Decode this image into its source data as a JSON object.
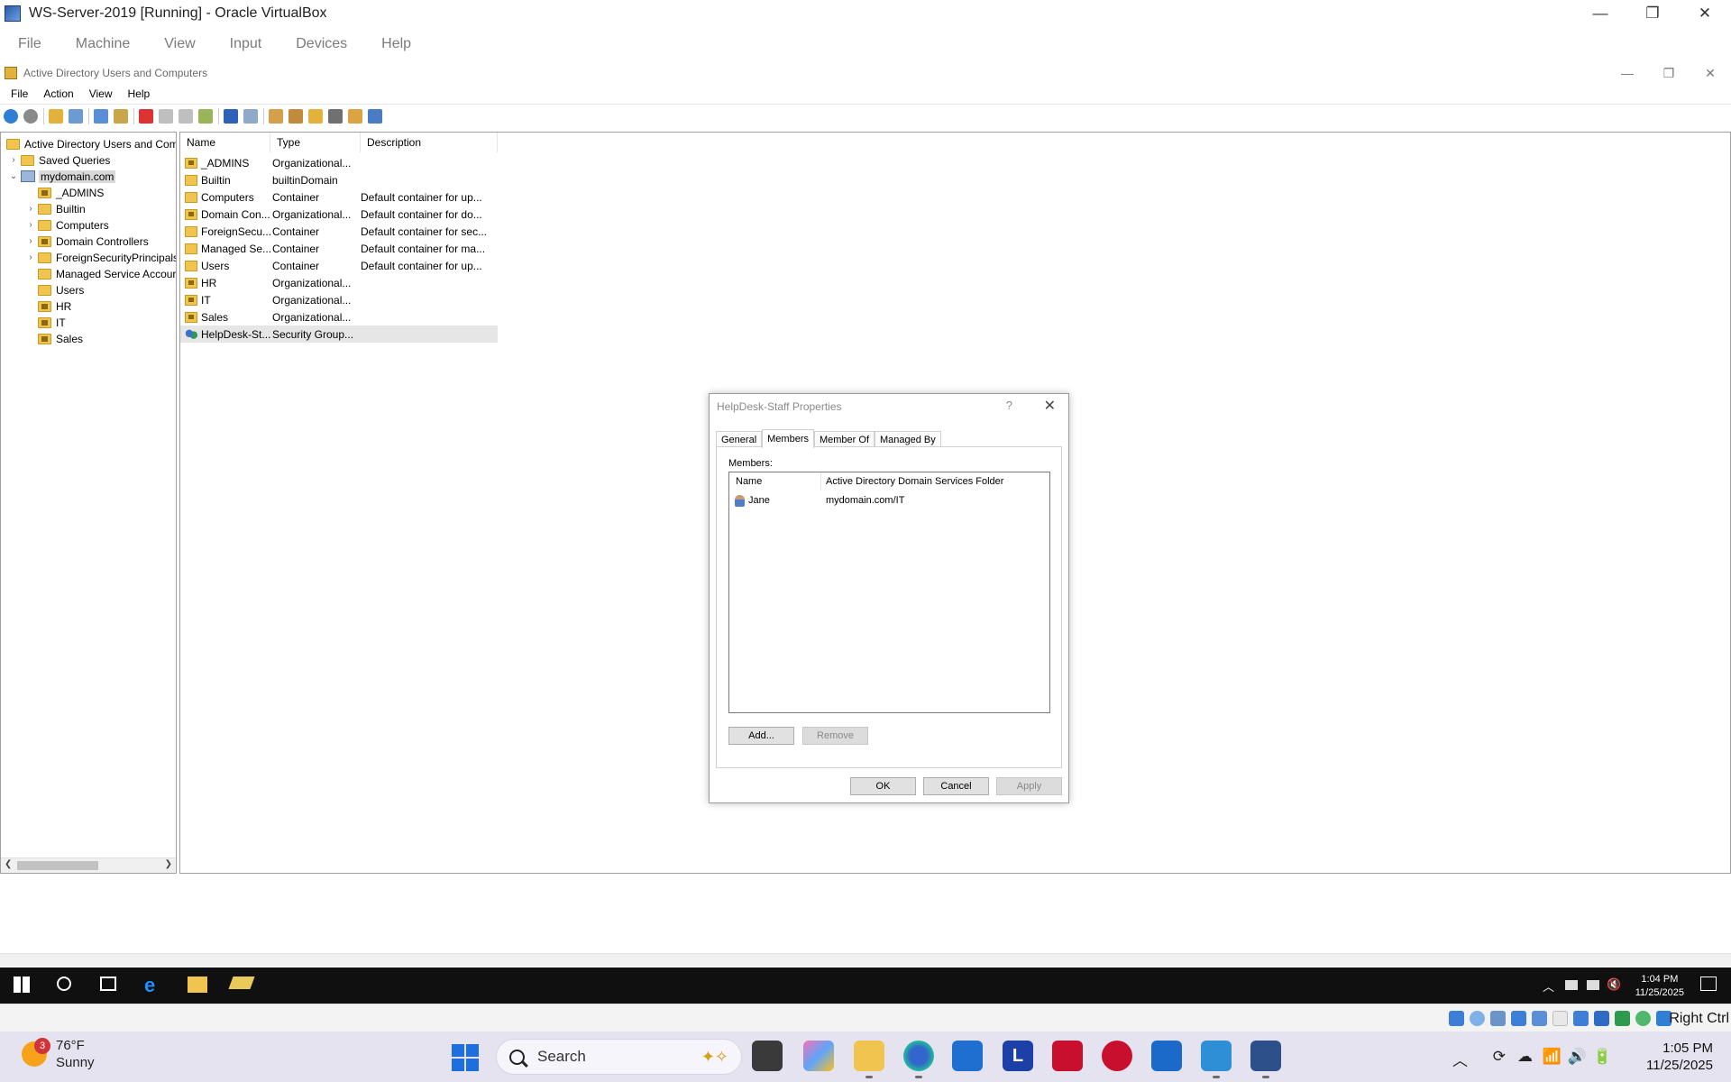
{
  "vbox": {
    "title": "WS-Server-2019 [Running] - Oracle VirtualBox",
    "menu": [
      "File",
      "Machine",
      "View",
      "Input",
      "Devices",
      "Help"
    ],
    "host_key": "Right Ctrl"
  },
  "aduc": {
    "title": "Active Directory Users and Computers",
    "menu": [
      "File",
      "Action",
      "View",
      "Help"
    ],
    "tree": [
      {
        "label": "Active Directory Users and Com",
        "icon": "aduc-root-icon",
        "expander": ""
      },
      {
        "label": "Saved Queries",
        "icon": "folder-icon",
        "expander": ">"
      },
      {
        "label": "mydomain.com",
        "icon": "domain-icon",
        "expander": "v"
      },
      {
        "label": "_ADMINS",
        "icon": "ou-icon",
        "expander": ""
      },
      {
        "label": "Builtin",
        "icon": "folder-icon",
        "expander": ">"
      },
      {
        "label": "Computers",
        "icon": "folder-icon",
        "expander": ">"
      },
      {
        "label": "Domain Controllers",
        "icon": "ou-icon",
        "expander": ">"
      },
      {
        "label": "ForeignSecurityPrincipals",
        "icon": "folder-icon",
        "expander": ">"
      },
      {
        "label": "Managed Service Accour",
        "icon": "folder-icon",
        "expander": ""
      },
      {
        "label": "Users",
        "icon": "folder-icon",
        "expander": ""
      },
      {
        "label": "HR",
        "icon": "ou-icon",
        "expander": ""
      },
      {
        "label": "IT",
        "icon": "ou-icon",
        "expander": ""
      },
      {
        "label": "Sales",
        "icon": "ou-icon",
        "expander": ""
      }
    ],
    "list_columns": [
      "Name",
      "Type",
      "Description"
    ],
    "list_rows": [
      {
        "name": "_ADMINS",
        "type": "Organizational...",
        "description": "",
        "icon": "ou"
      },
      {
        "name": "Builtin",
        "type": "builtinDomain",
        "description": "",
        "icon": "folder"
      },
      {
        "name": "Computers",
        "type": "Container",
        "description": "Default container for up...",
        "icon": "folder"
      },
      {
        "name": "Domain Con...",
        "type": "Organizational...",
        "description": "Default container for do...",
        "icon": "ou"
      },
      {
        "name": "ForeignSecu...",
        "type": "Container",
        "description": "Default container for sec...",
        "icon": "folder"
      },
      {
        "name": "Managed Se...",
        "type": "Container",
        "description": "Default container for ma...",
        "icon": "folder"
      },
      {
        "name": "Users",
        "type": "Container",
        "description": "Default container for up...",
        "icon": "folder"
      },
      {
        "name": "HR",
        "type": "Organizational...",
        "description": "",
        "icon": "ou"
      },
      {
        "name": "IT",
        "type": "Organizational...",
        "description": "",
        "icon": "ou"
      },
      {
        "name": "Sales",
        "type": "Organizational...",
        "description": "",
        "icon": "ou"
      },
      {
        "name": "HelpDesk-St...",
        "type": "Security Group...",
        "description": "",
        "icon": "grp"
      }
    ]
  },
  "dialog": {
    "title": "HelpDesk-Staff Properties",
    "help": "?",
    "tabs": [
      "General",
      "Members",
      "Member Of",
      "Managed By"
    ],
    "members_label": "Members:",
    "columns": {
      "name": "Name",
      "folder": "Active Directory Domain Services Folder"
    },
    "members": [
      {
        "name": "Jane",
        "folder": "mydomain.com/IT"
      }
    ],
    "add": "Add...",
    "remove": "Remove",
    "ok": "OK",
    "cancel": "Cancel",
    "apply": "Apply"
  },
  "guest_taskbar": {
    "time": "1:04 PM",
    "date": "11/25/2025"
  },
  "host_taskbar": {
    "weather_temp": "76°F",
    "weather_cond": "Sunny",
    "weather_badge": "3",
    "search_placeholder": "Search",
    "time": "1:05 PM",
    "date": "11/25/2025"
  },
  "colors": {
    "accent": "#1d6fe0",
    "selection": "#d9d9d9",
    "host_taskbar": "#e6e3f0"
  }
}
